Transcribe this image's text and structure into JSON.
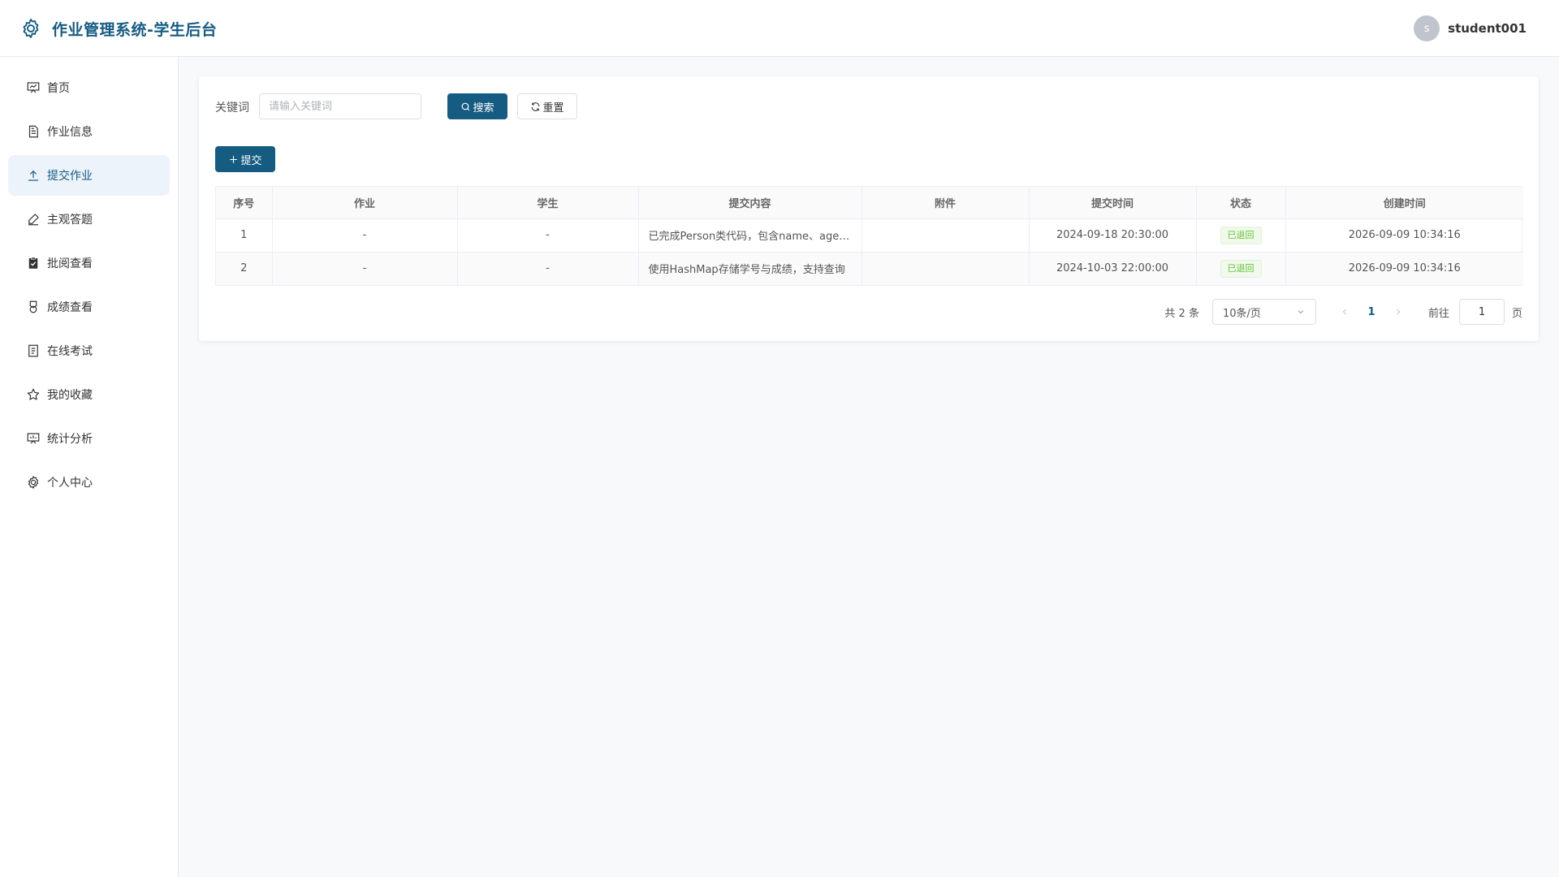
{
  "header": {
    "title": "作业管理系统-学生后台",
    "avatar_letter": "s",
    "username": "student001"
  },
  "sidebar": {
    "items": [
      {
        "label": "首页",
        "icon": "presentation-icon",
        "active": false
      },
      {
        "label": "作业信息",
        "icon": "document-icon",
        "active": false
      },
      {
        "label": "提交作业",
        "icon": "upload-icon",
        "active": true
      },
      {
        "label": "主观答题",
        "icon": "pen-icon",
        "active": false
      },
      {
        "label": "批阅查看",
        "icon": "clipboard-check-icon",
        "active": false
      },
      {
        "label": "成绩查看",
        "icon": "medal-icon",
        "active": false
      },
      {
        "label": "在线考试",
        "icon": "tickets-icon",
        "active": false
      },
      {
        "label": "我的收藏",
        "icon": "star-icon",
        "active": false
      },
      {
        "label": "统计分析",
        "icon": "data-board-icon",
        "active": false
      },
      {
        "label": "个人中心",
        "icon": "gear-icon",
        "active": false
      }
    ]
  },
  "search": {
    "label": "关键词",
    "placeholder": "请输入关键词",
    "value": "",
    "search_button": "搜索",
    "reset_button": "重置"
  },
  "toolbar": {
    "add_button": "提交"
  },
  "table": {
    "headers": [
      "序号",
      "作业",
      "学生",
      "提交内容",
      "附件",
      "提交时间",
      "状态",
      "创建时间"
    ],
    "rows": [
      {
        "index": "1",
        "homework": "-",
        "student": "-",
        "content": "已完成Person类代码，包含name、age属性",
        "attachment": "",
        "submit_time": "2024-09-18 20:30:00",
        "status": "已退回",
        "created": "2026-09-09 10:34:16"
      },
      {
        "index": "2",
        "homework": "-",
        "student": "-",
        "content": "使用HashMap存储学号与成绩，支持查询",
        "attachment": "",
        "submit_time": "2024-10-03 22:00:00",
        "status": "已退回",
        "created": "2026-09-09 10:34:16"
      }
    ]
  },
  "pagination": {
    "total_text": "共 2 条",
    "page_size": "10条/页",
    "current_page": "1",
    "goto_label": "前往",
    "goto_value": "1",
    "page_suffix": "页"
  },
  "colors": {
    "primary": "#155b82",
    "active_bg": "#ecf3fa",
    "status_green": "#67c23a"
  }
}
